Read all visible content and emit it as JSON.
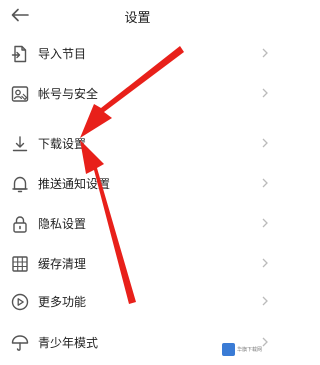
{
  "header": {
    "title": "设置",
    "back_icon": "arrow-left-icon"
  },
  "menu": {
    "items": [
      {
        "label": "导入节目",
        "icon": "import-icon"
      },
      {
        "label": "帐号与安全",
        "icon": "account-security-icon"
      },
      {
        "label": "下载设置",
        "icon": "download-icon"
      },
      {
        "label": "推送通知设置",
        "icon": "bell-icon"
      },
      {
        "label": "隐私设置",
        "icon": "lock-icon"
      },
      {
        "label": "缓存清理",
        "icon": "cache-grid-icon"
      },
      {
        "label": "更多功能",
        "icon": "play-circle-icon"
      },
      {
        "label": "青少年模式",
        "icon": "umbrella-icon"
      }
    ],
    "chevron_icon": "chevron-right-icon"
  },
  "annotation": {
    "arrow_color": "#e8201a"
  },
  "watermark": {
    "text": "华旗下载网"
  },
  "colors": {
    "icon": "#555555",
    "chevron": "#bbbbbb",
    "text": "#222222"
  }
}
